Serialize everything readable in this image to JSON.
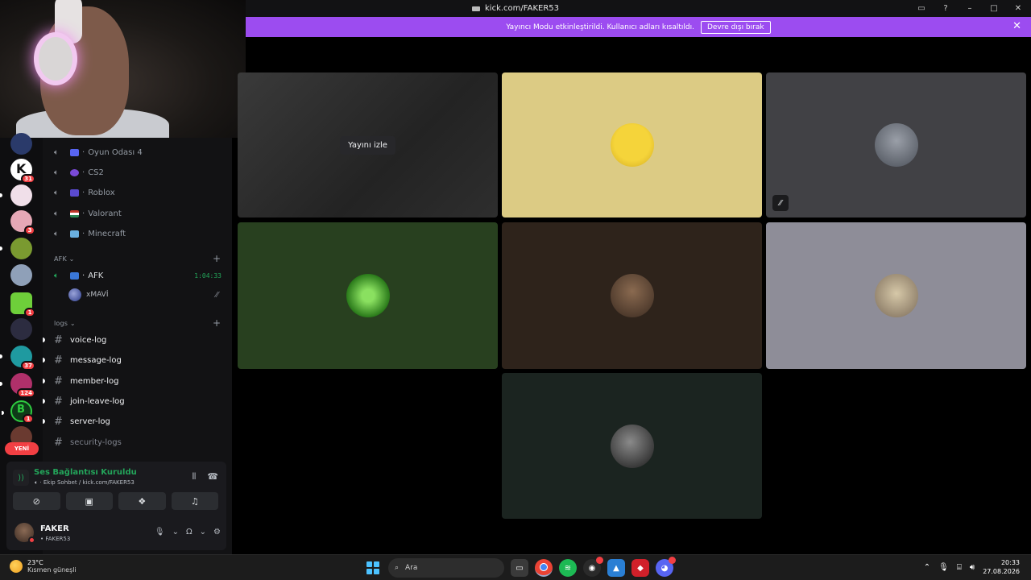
{
  "window": {
    "title": "kick.com/FAKER53",
    "controls": [
      "inbox-icon",
      "help-icon",
      "minimize-icon",
      "maximize-icon",
      "close-icon"
    ]
  },
  "banner": {
    "message": "Yayıncı Modu etkinleştirildi. Kullanıcı adları kısaltıldı.",
    "button": "Devre dışı bırak",
    "color": "#9c4cf0"
  },
  "servers": [
    {
      "icon": "kick-icon",
      "badge": "31",
      "color": "#1a1a1a"
    },
    {
      "icon": "server-pink",
      "badge": "",
      "color": "#e8d4e0"
    },
    {
      "icon": "server-anime",
      "badge": "3",
      "color": "#d98fa0"
    },
    {
      "icon": "server-leaf",
      "badge": "",
      "color": "#7a9a30"
    },
    {
      "icon": "server-alien",
      "badge": "",
      "color": "#8fa0b8"
    },
    {
      "icon": "server-cube",
      "badge": "1",
      "color": "#6ecf3a"
    },
    {
      "icon": "server-nexus",
      "badge": "",
      "color": "#2c2c40"
    },
    {
      "icon": "server-teal",
      "badge": "37",
      "color": "#1f9aa0"
    },
    {
      "icon": "server-red",
      "badge": "124",
      "color": "#b0306a"
    },
    {
      "icon": "server-b",
      "badge": "1",
      "color": "#0e3a18"
    }
  ],
  "new_label": "YENİ",
  "voice_channels": [
    {
      "name": "Oyun Odası 4",
      "emoji_color": "#5865f2"
    },
    {
      "name": "CS2",
      "emoji_color": "#7a4ad8"
    },
    {
      "name": "Roblox",
      "emoji_color": "#5a4ad0"
    },
    {
      "name": "Valorant",
      "emoji_color": "#c0392b"
    },
    {
      "name": "Minecraft",
      "emoji_color": "#6ab0e0"
    }
  ],
  "afk": {
    "category": "AFK",
    "channel": "AFK",
    "time": "1:04:33",
    "user": "xMAVİ"
  },
  "logs": {
    "category": "logs",
    "channels": [
      {
        "name": "voice-log",
        "unread": true
      },
      {
        "name": "message-log",
        "unread": true
      },
      {
        "name": "member-log",
        "unread": true
      },
      {
        "name": "join-leave-log",
        "unread": true
      },
      {
        "name": "server-log",
        "unread": true
      },
      {
        "name": "security-logs",
        "unread": false
      }
    ]
  },
  "voice_panel": {
    "status": "Ses Bağlantısı Kuruldu",
    "sub": "· Ekip Sohbet / kick.com/FAKER53",
    "user_name": "FAKER",
    "user_tag": "• FAKER53"
  },
  "tiles": [
    {
      "type": "stream",
      "label": "Yayını izle",
      "bg": "#2b2b2b"
    },
    {
      "type": "avatar",
      "bg": "#dccb84",
      "avatar": "minion-avatar",
      "av_color": "#f5d43a"
    },
    {
      "type": "avatar",
      "bg": "#414145",
      "avatar": "man-avatar",
      "av_color": "#8a8f98",
      "muted": true
    },
    {
      "type": "avatar",
      "bg": "#28401f",
      "avatar": "gaming-logo-avatar",
      "av_color": "#4aa83a"
    },
    {
      "type": "avatar",
      "bg": "#2e231b",
      "avatar": "mirror-selfie-avatar",
      "av_color": "#6b4a34"
    },
    {
      "type": "avatar",
      "bg": "#8e8d98",
      "avatar": "sloth-avatar",
      "av_color": "#b8a890"
    },
    {
      "type": "avatar",
      "bg": "#1b2420",
      "avatar": "dark-avatar",
      "av_color": "#4a4a4a"
    }
  ],
  "taskbar": {
    "temp": "23°C",
    "weather": "Kısmen güneşli",
    "search": "Ara",
    "apps": [
      "file-explorer",
      "chrome",
      "spotify",
      "steam",
      "photos",
      "app-red",
      "discord"
    ],
    "time": "20:33",
    "date": "27.08.2026"
  }
}
